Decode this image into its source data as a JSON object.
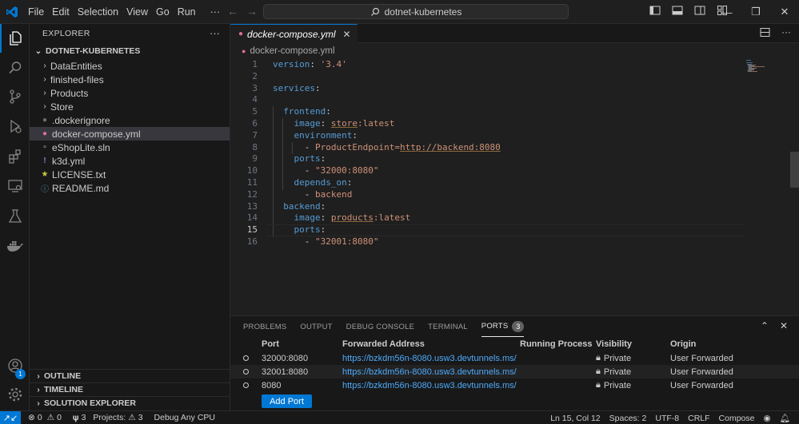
{
  "titlebar": {
    "menu": [
      "File",
      "Edit",
      "Selection",
      "View",
      "Go",
      "Run",
      "···"
    ],
    "search_text": "dotnet-kubernetes"
  },
  "activitybar": {
    "accounts_badge": "1",
    "items": [
      "explorer-icon",
      "search-icon",
      "source-control-icon",
      "run-debug-icon",
      "extensions-icon",
      "remote-explorer-icon",
      "testing-icon",
      "docker-icon"
    ]
  },
  "sidebar": {
    "title": "EXPLORER",
    "more": "···",
    "folder": "DOTNET-KUBERNETES",
    "items": [
      {
        "label": "DataEntities",
        "kind": "folder"
      },
      {
        "label": "finished-files",
        "kind": "folder"
      },
      {
        "label": "Products",
        "kind": "folder"
      },
      {
        "label": "Store",
        "kind": "folder"
      },
      {
        "label": ".dockerignore",
        "kind": "file"
      },
      {
        "label": "docker-compose.yml",
        "kind": "file"
      },
      {
        "label": "eShopLite.sln",
        "kind": "file"
      },
      {
        "label": "k3d.yml",
        "kind": "file"
      },
      {
        "label": "LICENSE.txt",
        "kind": "file"
      },
      {
        "label": "README.md",
        "kind": "file"
      }
    ],
    "sections": [
      "OUTLINE",
      "TIMELINE",
      "SOLUTION EXPLORER"
    ]
  },
  "editor": {
    "tab_label": "docker-compose.yml",
    "breadcrumb": "docker-compose.yml",
    "line_numbers": [
      "1",
      "2",
      "3",
      "4",
      "5",
      "6",
      "7",
      "8",
      "9",
      "10",
      "11",
      "12",
      "13",
      "14",
      "15",
      "16"
    ],
    "code": {
      "l1_key": "version",
      "l1_colon": ": ",
      "l1_val": "'3.4'",
      "l3_key": "services",
      "l3_colon": ":",
      "l5_key": "frontend",
      "l5_colon": ":",
      "l6_key": "image",
      "l6_colon": ": ",
      "l6_val_a": "store",
      "l6_val_b": ":latest",
      "l7_key": "environment",
      "l7_colon": ":",
      "l8_dash": "- ",
      "l8_val_a": "ProductEndpoint=",
      "l8_val_b": "http://backend:8080",
      "l9_key": "ports",
      "l9_colon": ":",
      "l10_dash": "- ",
      "l10_val": "\"32000:8080\"",
      "l11_key": "depends_on",
      "l11_colon": ":",
      "l12_dash": "- ",
      "l12_val": "backend",
      "l13_key": "backend",
      "l13_colon": ":",
      "l14_key": "image",
      "l14_colon": ": ",
      "l14_val_a": "products",
      "l14_val_b": ":latest",
      "l15_key": "ports",
      "l15_colon": ":",
      "l16_dash": "- ",
      "l16_val": "\"32001:8080\""
    }
  },
  "panel": {
    "tabs": [
      "PROBLEMS",
      "OUTPUT",
      "DEBUG CONSOLE",
      "TERMINAL",
      "PORTS"
    ],
    "ports_count": "3",
    "columns": [
      "Port",
      "Forwarded Address",
      "Running Process",
      "Visibility",
      "Origin"
    ],
    "rows": [
      {
        "port": "32000:8080",
        "address": "https://bzkdm56n-8080.usw3.devtunnels.ms/",
        "process": "",
        "visibility": "Private",
        "origin": "User Forwarded"
      },
      {
        "port": "32001:8080",
        "address": "https://bzkdm56n-8080.usw3.devtunnels.ms/",
        "process": "",
        "visibility": "Private",
        "origin": "User Forwarded"
      },
      {
        "port": "8080",
        "address": "https://bzkdm56n-8080.usw3.devtunnels.ms/",
        "process": "",
        "visibility": "Private",
        "origin": "User Forwarded"
      }
    ],
    "add_port_label": "Add Port"
  },
  "statusbar": {
    "remote_icon": "remote-icon",
    "errors": "0",
    "warnings": "0",
    "ports": "3",
    "projects": "Projects: ",
    "projects_warn": "3",
    "debug": "Debug Any CPU",
    "position": "Ln 15, Col 12",
    "spaces": "Spaces: 2",
    "encoding": "UTF-8",
    "eol": "CRLF",
    "language": "Compose"
  },
  "colors": {
    "accent": "#0078d4",
    "key": "#569cd6",
    "string": "#ce9178",
    "link": "#4daafc"
  }
}
